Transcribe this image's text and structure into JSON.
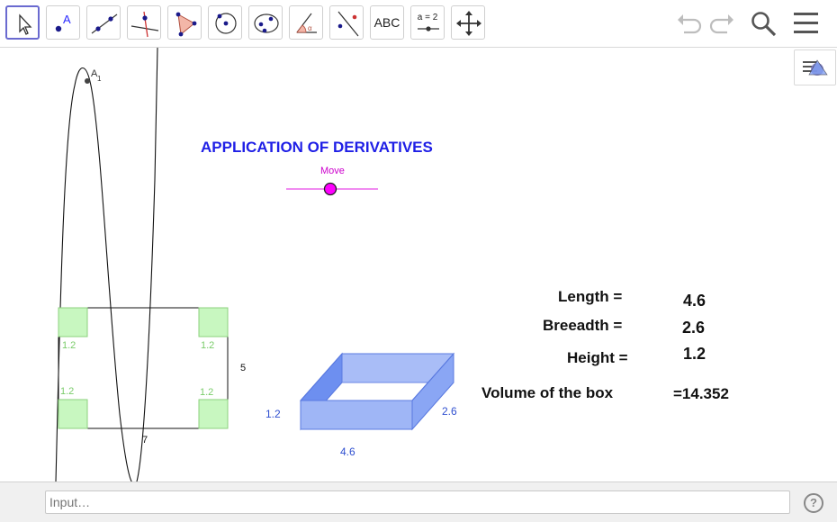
{
  "toolbar": {
    "abc_label": "ABC",
    "slider_tool_label": "a = 2"
  },
  "graphics": {
    "title": "APPLICATION OF DERIVATIVES",
    "slider_label": "Move",
    "point_label": "A",
    "point_subscript": "1",
    "net": {
      "cut_labels": [
        "1.2",
        "1.2",
        "1.2",
        "1.2"
      ],
      "side_label": "5",
      "bottom_label": "7"
    },
    "box": {
      "height_label": "1.2",
      "depth_label": "2.6",
      "length_label": "4.6"
    },
    "results": {
      "length_label": "Length =",
      "length_value": "4.6",
      "breadth_label": "Breeadth =",
      "breadth_value": "2.6",
      "height_label": "Height =",
      "height_value": "1.2",
      "volume_label": "Volume of the box",
      "volume_value": "=14.352"
    }
  },
  "input_bar": {
    "placeholder": "Input…",
    "help_symbol": "?"
  },
  "colors": {
    "title": "#1f1fe6",
    "slider": "#ff00ff",
    "cut_fill": "#c8f7c0",
    "box_fill": "#7c9cf2"
  }
}
